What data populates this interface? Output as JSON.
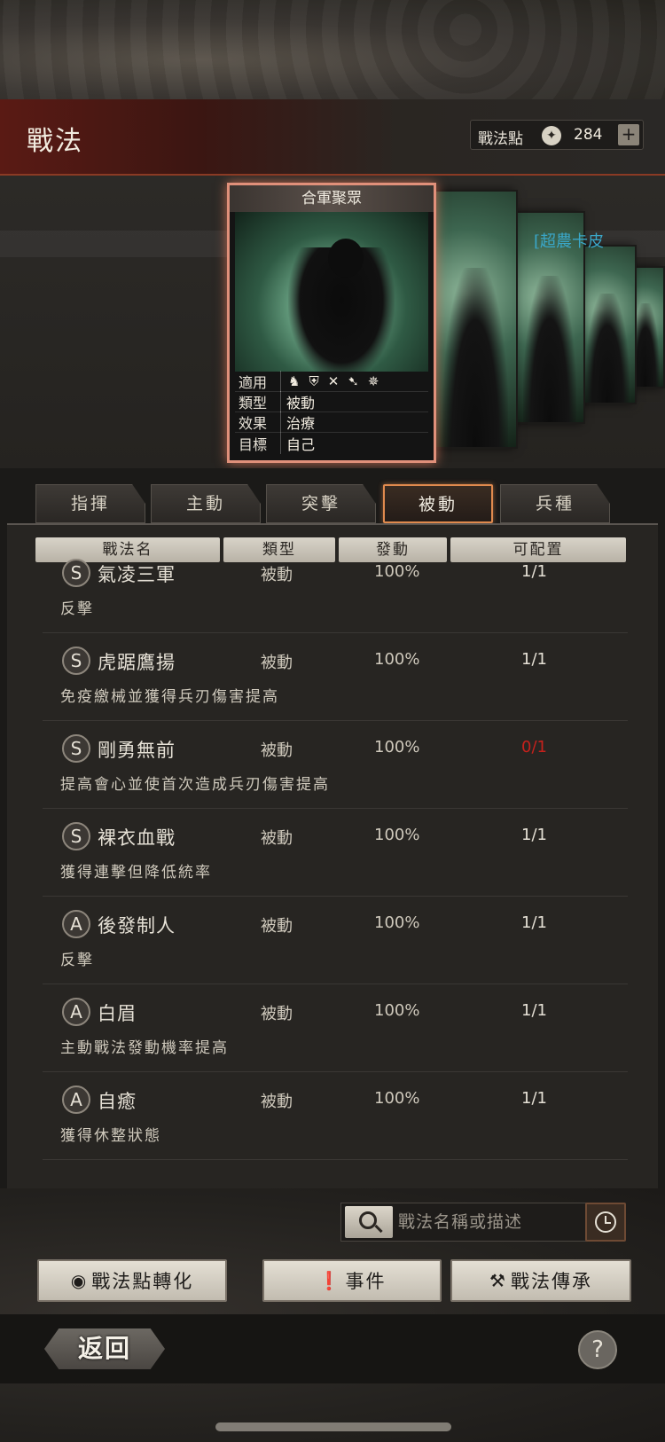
{
  "header": {
    "title": "戰法",
    "points_label": "戰法點",
    "points_value": "284",
    "plus_label": "+"
  },
  "card": {
    "name": "合軍聚眾",
    "side_label": "[超農卡皮",
    "info": [
      {
        "key": "適用",
        "value": ""
      },
      {
        "key": "類型",
        "value": "被動"
      },
      {
        "key": "效果",
        "value": "治療"
      },
      {
        "key": "目標",
        "value": "自己"
      }
    ],
    "troop_icons": [
      "cavalry-icon",
      "shield-icon",
      "archer-icon",
      "spear-icon",
      "chariot-icon"
    ]
  },
  "tabs": [
    {
      "label": "指揮",
      "active": false
    },
    {
      "label": "主動",
      "active": false
    },
    {
      "label": "突擊",
      "active": false
    },
    {
      "label": "被動",
      "active": true
    },
    {
      "label": "兵種",
      "active": false
    }
  ],
  "columns": [
    "戰法名",
    "類型",
    "發動",
    "可配置"
  ],
  "rows": [
    {
      "grade": "S",
      "name": "氣凌三軍",
      "type": "被動",
      "rate": "100%",
      "config": "1/1",
      "config_color": "#e6e1d6",
      "desc": "反擊"
    },
    {
      "grade": "S",
      "name": "虎踞鷹揚",
      "type": "被動",
      "rate": "100%",
      "config": "1/1",
      "config_color": "#e6e1d6",
      "desc": "免疫繳械並獲得兵刃傷害提高"
    },
    {
      "grade": "S",
      "name": "剛勇無前",
      "type": "被動",
      "rate": "100%",
      "config": "0/1",
      "config_color": "#c6211c",
      "desc": "提高會心並使首次造成兵刃傷害提高"
    },
    {
      "grade": "S",
      "name": "裸衣血戰",
      "type": "被動",
      "rate": "100%",
      "config": "1/1",
      "config_color": "#e6e1d6",
      "desc": "獲得連擊但降低統率"
    },
    {
      "grade": "A",
      "name": "後發制人",
      "type": "被動",
      "rate": "100%",
      "config": "1/1",
      "config_color": "#e6e1d6",
      "desc": "反擊"
    },
    {
      "grade": "A",
      "name": "白眉",
      "type": "被動",
      "rate": "100%",
      "config": "1/1",
      "config_color": "#e6e1d6",
      "desc": "主動戰法發動機率提高"
    },
    {
      "grade": "A",
      "name": "自癒",
      "type": "被動",
      "rate": "100%",
      "config": "1/1",
      "config_color": "#e6e1d6",
      "desc": "獲得休整狀態"
    }
  ],
  "search": {
    "placeholder": "戰法名稱或描述"
  },
  "actions": {
    "convert_label": "戰法點轉化",
    "event_label": "事件",
    "inherit_label": "戰法傳承"
  },
  "footer": {
    "back_label": "返回",
    "help_label": "?"
  }
}
